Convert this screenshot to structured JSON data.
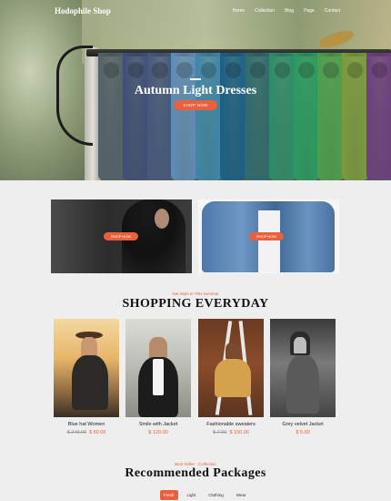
{
  "nav": {
    "brand": "Hodophile Shop",
    "menu": [
      "Home",
      "Collection",
      "Blog",
      "Page",
      "Contact"
    ]
  },
  "hero": {
    "title": "Autumn Light Dresses",
    "button": "SHOP NOW"
  },
  "promos": [
    {
      "button": "SHOP NOW"
    },
    {
      "button": "SHOP NOW"
    }
  ],
  "shopping": {
    "kicker": "Get Style In This Summer",
    "title": "SHOPPING EVERYDAY"
  },
  "products": [
    {
      "name": "Blue hat Women",
      "old_price": "$ 248.08",
      "price": "$ 50.00"
    },
    {
      "name": "Smile with Jacket",
      "old_price": "",
      "price": "$ 120.00"
    },
    {
      "name": "Fashionable sweaters",
      "old_price": "$ 7.00",
      "price": "$ 150.00"
    },
    {
      "name": "Grey velvet Jacket",
      "old_price": "",
      "price": "$ 5.00"
    }
  ],
  "recommended": {
    "kicker": "Best Seller - Collection",
    "title": "Recommended Packages",
    "tabs": [
      "Fresh",
      "Light",
      "Clothing",
      "Wear"
    ]
  },
  "colors": {
    "accent": "#e8603c",
    "page_bg": "#eeeeee"
  },
  "scarf_colors": [
    "#53616a",
    "#3f4f78",
    "#46587e",
    "#5f8cb6",
    "#3e86a8",
    "#1c5f86",
    "#2e6a6e",
    "#2e8c6a",
    "#2a9a62",
    "#4c9e4e",
    "#7a9a3e",
    "#6d3f80"
  ]
}
